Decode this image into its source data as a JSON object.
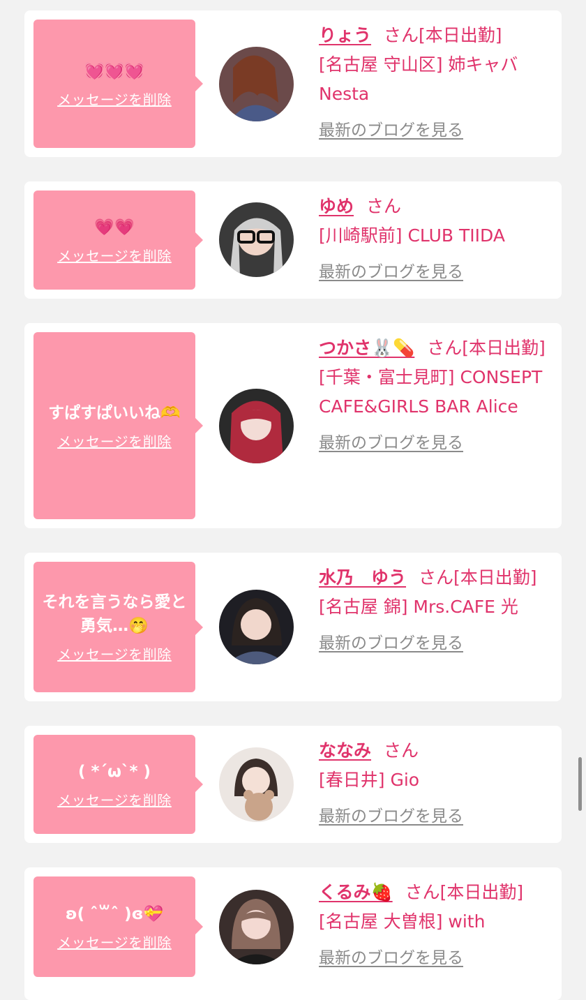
{
  "delete_label": "メッセージを削除",
  "blog_label": "最新のブログを見る",
  "san_label": "さん",
  "colors": {
    "bubble": "#fd98ac",
    "accent": "#e0336b",
    "link_gray": "#8a8a8a"
  },
  "cards": [
    {
      "message": "💓💓💓",
      "name": "りょう",
      "status": "[本日出勤]",
      "shop": "[名古屋 守山区] 姉キャバ Nesta",
      "avatar_icon": "avatar-photo"
    },
    {
      "message": "💗💗",
      "name": "ゆめ",
      "status": "",
      "shop": "[川崎駅前] CLUB TIIDA",
      "avatar_icon": "avatar-photo"
    },
    {
      "message": "すぱすぱいいね🫶",
      "name": "つかさ🐰💊",
      "status": "[本日出勤]",
      "shop": "[千葉・富士見町] CONSEPT CAFE&GIRLS BAR Alice",
      "avatar_icon": "avatar-photo"
    },
    {
      "message": "それを言うなら愛と勇気…🤭",
      "name": "水乃　ゆう",
      "status": "[本日出勤]",
      "shop": "[名古屋 錦] Mrs.CAFE 光",
      "avatar_icon": "avatar-photo"
    },
    {
      "message": "( *´ω`* )",
      "name": "ななみ",
      "status": "",
      "shop": "[春日井] Gio",
      "avatar_icon": "avatar-photo"
    },
    {
      "message": "ʚ( ˆ꒳ˆ )ɞ💝",
      "name": "くるみ🍓",
      "status": "[本日出勤]",
      "shop": "[名古屋 大曽根] with",
      "avatar_icon": "avatar-photo"
    }
  ]
}
